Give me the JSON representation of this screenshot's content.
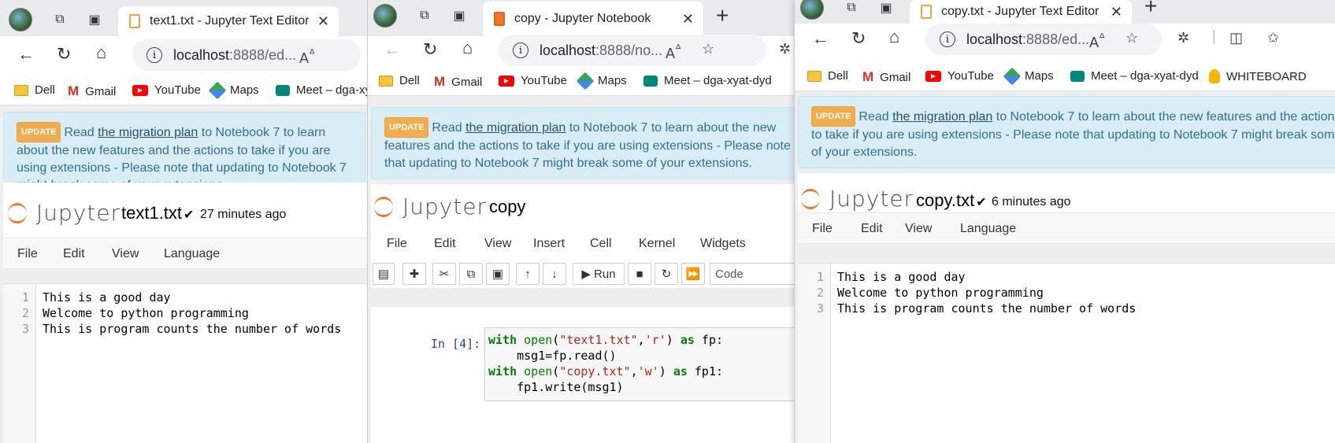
{
  "bookmark_labels": {
    "dell": "Dell",
    "gmail": "Gmail",
    "youtube": "YouTube",
    "maps": "Maps",
    "meet": "Meet – dga-xyat-dyd",
    "whiteboard": "WHITEBOARD"
  },
  "alert": {
    "badge": "UPDATE",
    "pre": "Read ",
    "link": "the migration plan",
    "post": " to Notebook 7 to learn about the new features and the actions to take if you are using extensions - Please note that updating to Notebook 7 might break some of your extensions."
  },
  "jupyter_logo_text": "Jupyter",
  "check_mark": "✔",
  "window1": {
    "tab_title": "text1.txt - Jupyter Text Editor",
    "address_host": "localhost",
    "address_rest": ":8888/ed...",
    "file_name": "text1.txt",
    "saved": "27 minutes ago",
    "menu": [
      "File",
      "Edit",
      "View",
      "Language"
    ],
    "line_numbers": [
      "1",
      "2",
      "3"
    ],
    "lines": [
      "This is a good day",
      "Welcome to python programming",
      "This is program counts the number of words"
    ]
  },
  "window2": {
    "tab_title": "copy - Jupyter Notebook",
    "address_host": "localhost",
    "address_rest": ":8888/no...",
    "notebook_name": "copy",
    "menu": [
      "File",
      "Edit",
      "View",
      "Insert",
      "Cell",
      "Kernel",
      "Widgets"
    ],
    "run_label": "Run",
    "cell_type": "Code",
    "cell_prompt": "In [4]:",
    "code": {
      "l1_kw": "with",
      "l1_bi": "open",
      "l1_p1": "(",
      "l1_s1": "\"text1.txt\"",
      "l1_p2": ",",
      "l1_s2": "'r'",
      "l1_p3": ") ",
      "l1_kw2": "as",
      "l1_rest": " fp:",
      "l2": "    msg1=fp.read()",
      "l3_kw": "with",
      "l3_bi": "open",
      "l3_p1": "(",
      "l3_s1": "\"copy.txt\"",
      "l3_p2": ",",
      "l3_s2": "'w'",
      "l3_p3": ") ",
      "l3_kw2": "as",
      "l3_rest": " fp1:",
      "l4": "    fp1.write(msg1)"
    }
  },
  "window3": {
    "tab_title": "copy.txt - Jupyter Text Editor",
    "address_host": "localhost",
    "address_rest": ":8888/ed...",
    "file_name": "copy.txt",
    "saved": "6 minutes ago",
    "menu": [
      "File",
      "Edit",
      "View",
      "Language"
    ],
    "line_numbers": [
      "1",
      "2",
      "3"
    ],
    "lines": [
      "This is a good day",
      "Welcome to python programming",
      "This is program counts the number of words"
    ]
  },
  "colors": {
    "jupyter_orange": "#f37626",
    "alert_bg": "#d9edf7",
    "alert_text": "#31708f",
    "update_badge": "#f0ad4e"
  }
}
